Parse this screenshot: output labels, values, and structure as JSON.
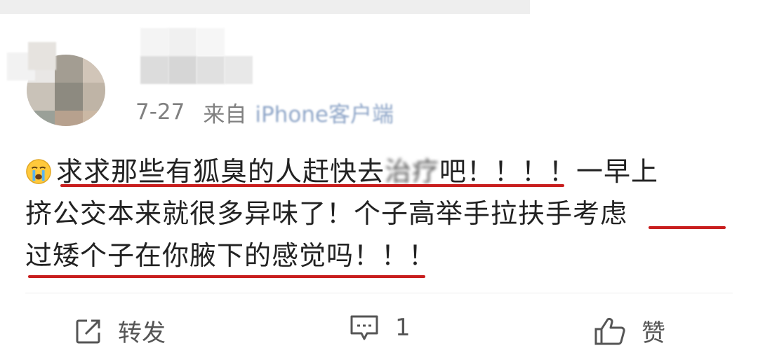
{
  "post": {
    "date": "7-27",
    "source_prefix": "来自",
    "source": "iPhone客户端",
    "content": {
      "line1_pre": "求求那些有狐臭的人赶快去",
      "line1_blur": "治疗",
      "line1_post": "吧！！！！一早上",
      "line2": "挤公交本来就很多异味了！个子高举手拉扶手考虑",
      "line3": "过矮个子在你腋下的感觉吗！！！"
    }
  },
  "actions": {
    "repost_label": "转发",
    "comment_count": "1",
    "like_label": "赞"
  },
  "icons": {
    "emoji": "crying-face-emoji",
    "repost": "share-icon",
    "comment": "comment-icon",
    "like": "thumbs-up-icon"
  },
  "colors": {
    "highlight_underline": "#c81e1e",
    "meta_text": "#808080",
    "source_text": "#8fa6c8"
  }
}
